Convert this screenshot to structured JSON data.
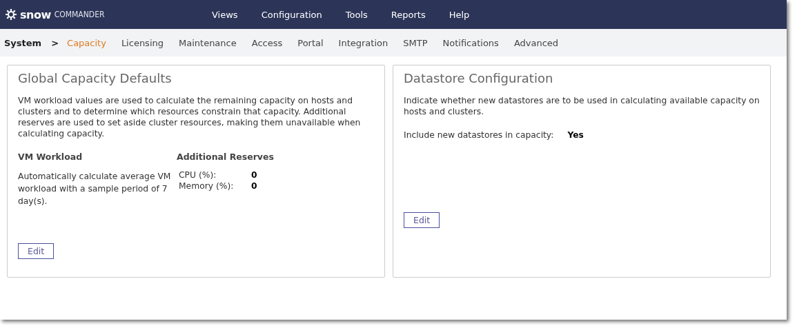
{
  "logo": {
    "brand": "snow",
    "product": "COMMANDER"
  },
  "menu": [
    {
      "label": "Views"
    },
    {
      "label": "Configuration"
    },
    {
      "label": "Tools"
    },
    {
      "label": "Reports"
    },
    {
      "label": "Help"
    }
  ],
  "breadcrumb": {
    "root": "System",
    "separator": ">"
  },
  "tabs": [
    {
      "label": "Capacity",
      "selected": true
    },
    {
      "label": "Licensing",
      "selected": false
    },
    {
      "label": "Maintenance",
      "selected": false
    },
    {
      "label": "Access",
      "selected": false
    },
    {
      "label": "Portal",
      "selected": false
    },
    {
      "label": "Integration",
      "selected": false
    },
    {
      "label": "SMTP",
      "selected": false
    },
    {
      "label": "Notifications",
      "selected": false
    },
    {
      "label": "Advanced",
      "selected": false
    }
  ],
  "global_capacity": {
    "title": "Global Capacity Defaults",
    "description": "VM workload values are used to calculate the remaining capacity on hosts and clusters and to determine which resources constrain that capacity. Additional reserves are used to set aside cluster resources, making them unavailable when calculating capacity.",
    "workload_heading": "VM Workload",
    "workload_text": "Automatically calculate average VM workload with a sample period of 7 day(s).",
    "reserves_heading": "Additional Reserves",
    "reserves": [
      {
        "label": "CPU (%):",
        "value": "0"
      },
      {
        "label": "Memory (%):",
        "value": "0"
      }
    ],
    "button": "Edit"
  },
  "datastore": {
    "title": "Datastore Configuration",
    "description": "Indicate whether new datastores are to be used in calculating available capacity on hosts and clusters.",
    "setting_label": "Include new datastores in capacity:",
    "setting_value": "Yes",
    "button": "Edit"
  }
}
